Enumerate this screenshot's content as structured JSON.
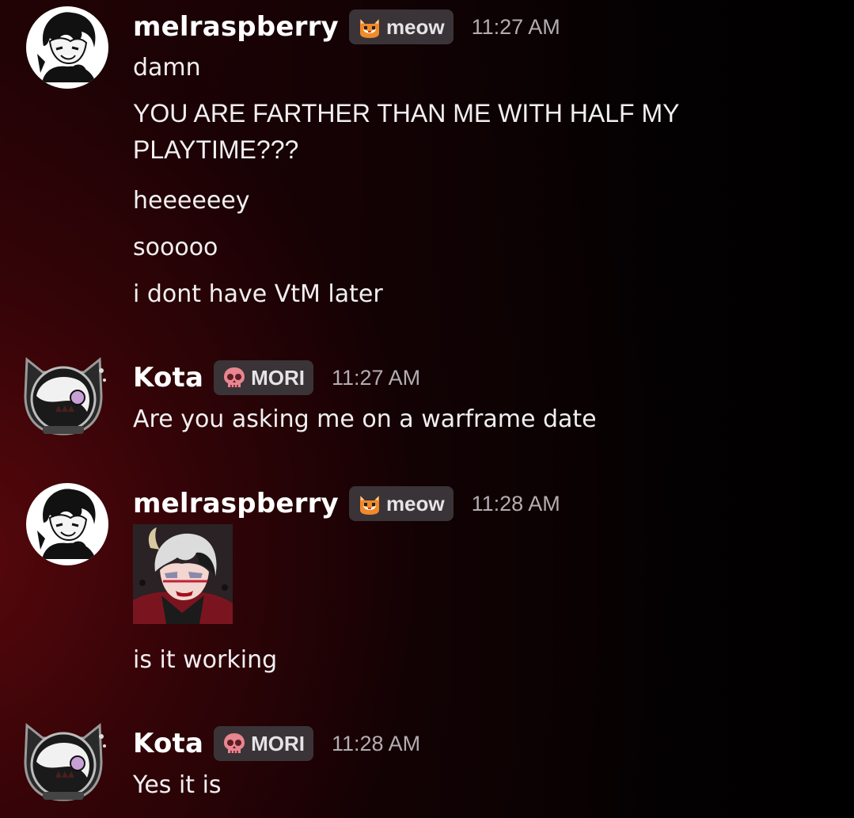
{
  "messages": [
    {
      "author": "melraspberry",
      "tag": {
        "label": "meow",
        "icon": "cat-face-icon"
      },
      "time": "11:27 AM",
      "lines": [
        "damn",
        "YOU ARE FARTHER THAN ME WITH HALF MY PLAYTIME???",
        "heeeeeey",
        "sooooo",
        "i dont have VtM later"
      ]
    },
    {
      "author": "Kota",
      "tag": {
        "label": "MORI",
        "icon": "skull-icon"
      },
      "time": "11:27 AM",
      "lines": [
        "Are you asking me on a warframe date"
      ]
    },
    {
      "author": "melraspberry",
      "tag": {
        "label": "meow",
        "icon": "cat-face-icon"
      },
      "time": "11:28 AM",
      "sticker": "character-portrait-sticker",
      "lines": [
        "is it working"
      ]
    },
    {
      "author": "Kota",
      "tag": {
        "label": "MORI",
        "icon": "skull-icon"
      },
      "time": "11:28 AM",
      "lines": [
        "Yes it is"
      ]
    }
  ],
  "colors": {
    "background_accent": "#5a080c",
    "tag_background": "#3a3438",
    "timestamp": "#b3adb1",
    "text": "#f2eff1",
    "skull_icon": "#e8858f",
    "cat_icon": "#f08a2a"
  }
}
